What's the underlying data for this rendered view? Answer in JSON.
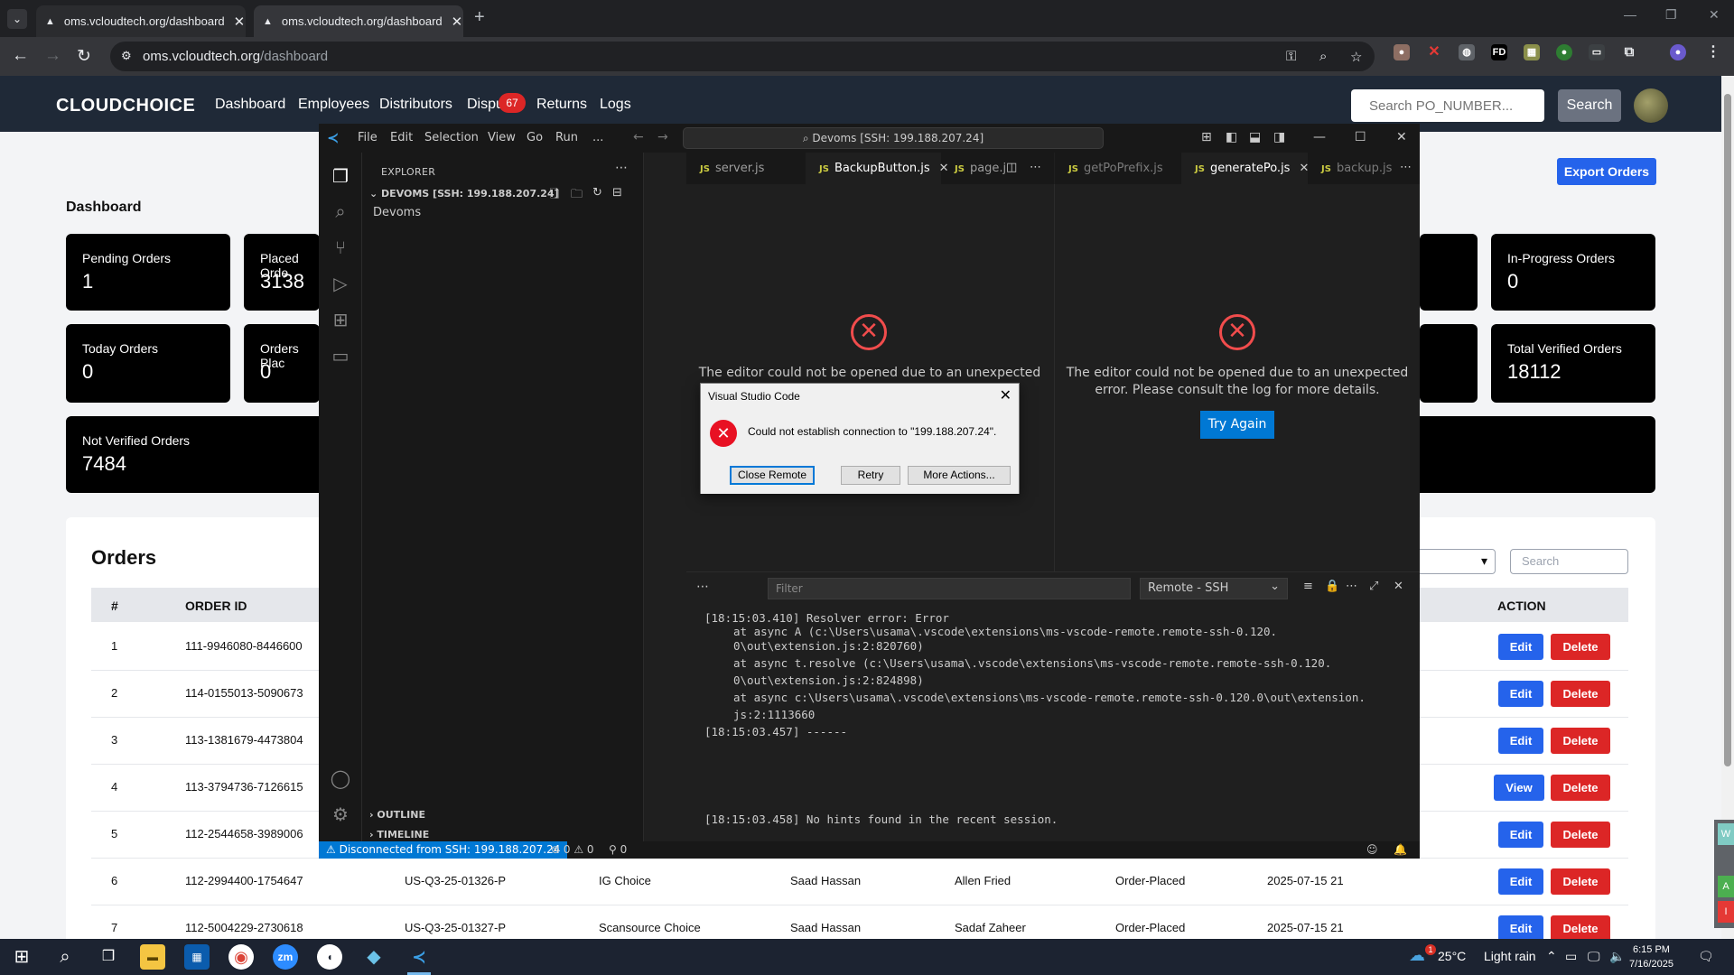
{
  "browser": {
    "tabs": [
      {
        "title": "oms.vcloudtech.org/dashboard"
      },
      {
        "title": "oms.vcloudtech.org/dashboard"
      }
    ],
    "url_domain": "oms.vcloudtech.org",
    "url_path": "/dashboard"
  },
  "site": {
    "logo": "CLOUDCHOICE",
    "nav": [
      "Dashboard",
      "Employees",
      "Distributors",
      "Dispu",
      "Returns",
      "Logs"
    ],
    "nav_badge": "67",
    "search_placeholder": "Search PO_NUMBER...",
    "search_button": "Search",
    "export_button": "Export Orders",
    "dashboard_title": "Dashboard",
    "cards": [
      {
        "title": "Pending Orders",
        "value": "1"
      },
      {
        "title": "Placed Orde",
        "value": "3138"
      },
      {
        "title": "In-Progress Orders",
        "value": "0"
      },
      {
        "title": "Today Orders",
        "value": "0"
      },
      {
        "title": "Orders Plac",
        "value": "0"
      },
      {
        "title": "Total Verified Orders",
        "value": "18112"
      },
      {
        "title": "Not Verified Orders",
        "value": "7484"
      }
    ],
    "orders_title": "Orders",
    "orders_search_placeholder": "Search",
    "table_headers": {
      "num": "#",
      "order_id": "ORDER ID",
      "action": "ACTION"
    },
    "rows": [
      {
        "num": "1",
        "order_id": "111-9946080-8446600",
        "po": "",
        "distributor": "",
        "employee": "",
        "customer": "",
        "status": "",
        "date": "",
        "primary": "Edit"
      },
      {
        "num": "2",
        "order_id": "114-0155013-5090673",
        "po": "",
        "distributor": "",
        "employee": "",
        "customer": "",
        "status": "",
        "date": "",
        "primary": "Edit"
      },
      {
        "num": "3",
        "order_id": "113-1381679-4473804",
        "po": "",
        "distributor": "",
        "employee": "",
        "customer": "",
        "status": "",
        "date": "",
        "primary": "Edit"
      },
      {
        "num": "4",
        "order_id": "113-3794736-7126615",
        "po": "",
        "distributor": "",
        "employee": "",
        "customer": "",
        "status": "",
        "date": "",
        "primary": "View"
      },
      {
        "num": "5",
        "order_id": "112-2544658-3989006",
        "po": "",
        "distributor": "",
        "employee": "",
        "customer": "",
        "status": "",
        "date": "",
        "primary": "Edit"
      },
      {
        "num": "6",
        "order_id": "112-2994400-1754647",
        "po": "US-Q3-25-01326-P",
        "distributor": "IG Choice",
        "employee": "Saad Hassan",
        "customer": "Allen Fried",
        "status": "Order-Placed",
        "date": "2025-07-15 21",
        "primary": "Edit"
      },
      {
        "num": "7",
        "order_id": "112-5004229-2730618",
        "po": "US-Q3-25-01327-P",
        "distributor": "Scansource Choice",
        "employee": "Saad Hassan",
        "customer": "Sadaf Zaheer",
        "status": "Order-Placed",
        "date": "2025-07-15 21",
        "primary": "Edit"
      }
    ],
    "delete_label": "Delete"
  },
  "vscode": {
    "menu": [
      "File",
      "Edit",
      "Selection",
      "View",
      "Go",
      "Run",
      "..."
    ],
    "command_center": "Devoms [SSH: 199.188.207.24]",
    "explorer_title": "EXPLORER",
    "workspace": "DEVOMS [SSH: 199.188.207.24]",
    "folder": "Devoms",
    "outline": "OUTLINE",
    "timeline": "TIMELINE",
    "tabs_left": [
      "server.js",
      "BackupButton.js",
      "page.j"
    ],
    "tabs_right": [
      "getPoPrefix.js",
      "generatePo.js",
      "backup.js"
    ],
    "editor_error_left": "The editor could not be opened due to an unexpected",
    "editor_error_right_1": "The editor could not be opened due to an unexpected",
    "editor_error_right_2": "error. Please consult the log for more details.",
    "try_again": "Try Again",
    "panel_filter_placeholder": "Filter",
    "panel_select": "Remote - SSH",
    "log_lines": [
      {
        "text": "[18:15:03.410] Resolver error: Error",
        "indent": false
      },
      {
        "text": "at async A (c:\\Users\\usama\\.vscode\\extensions\\ms-vscode-remote.remote-ssh-0.120.",
        "indent": true
      },
      {
        "text": "0\\out\\extension.js:2:820760)",
        "indent": true
      },
      {
        "text": "at async t.resolve (c:\\Users\\usama\\.vscode\\extensions\\ms-vscode-remote.remote-ssh-0.120.",
        "indent": true
      },
      {
        "text": "0\\out\\extension.js:2:824898)",
        "indent": true
      },
      {
        "text": "at async c:\\Users\\usama\\.vscode\\extensions\\ms-vscode-remote.remote-ssh-0.120.0\\out\\extension.",
        "indent": true
      },
      {
        "text": "js:2:1113660",
        "indent": true
      },
      {
        "text": "[18:15:03.457] ------",
        "indent": false
      },
      {
        "text": "[18:15:03.458] No hints found in the recent session.",
        "indent": false
      }
    ],
    "status_remote": "Disconnected from SSH: 199.188.207.24",
    "status_errors": "0",
    "status_warnings": "0",
    "status_ports": "0"
  },
  "dialog": {
    "title": "Visual Studio Code",
    "message": "Could not establish connection to \"199.188.207.24\".",
    "buttons": [
      "Close Remote",
      "Retry",
      "More Actions..."
    ]
  },
  "taskbar": {
    "weather_temp": "25°C",
    "weather_text": "Light rain",
    "time": "6:15 PM",
    "date": "7/16/2025",
    "weather_badge": "1"
  }
}
